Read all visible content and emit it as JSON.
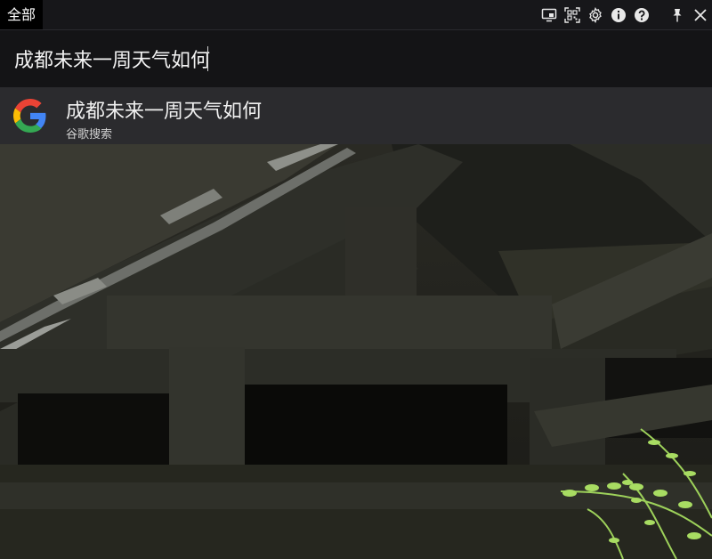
{
  "header": {
    "tab_label": "全部",
    "icons": [
      "screen-icon",
      "qr-scan-icon",
      "gear-icon",
      "info-icon",
      "help-icon",
      "pin-icon",
      "close-icon"
    ]
  },
  "search": {
    "value": "成都未来一周天气如何"
  },
  "suggestion": {
    "title": "成都未来一周天气如何",
    "subtitle": "谷歌搜索",
    "icon": "google-logo-icon"
  },
  "colors": {
    "topbar_bg": "#17171a",
    "search_bg": "#141416",
    "suggestion_bg": "#2b2b2e",
    "text": "#f0f0f0",
    "google_blue": "#4285F4",
    "google_red": "#EA4335",
    "google_yellow": "#FBBC05",
    "google_green": "#34A853"
  }
}
